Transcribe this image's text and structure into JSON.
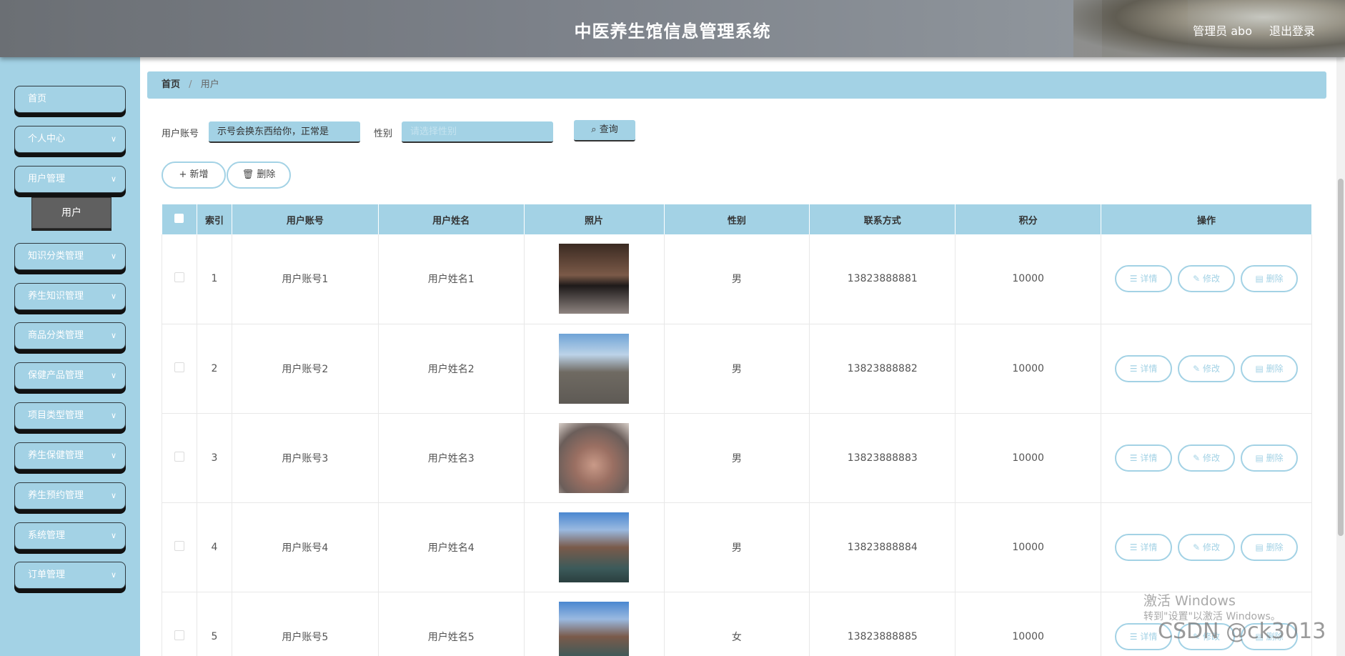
{
  "header": {
    "title": "中医养生馆信息管理系统",
    "user": "管理员 abo",
    "logout": "退出登录"
  },
  "sidebar": {
    "items": [
      {
        "label": "首页",
        "expandable": false
      },
      {
        "label": "个人中心",
        "expandable": true
      },
      {
        "label": "用户管理",
        "expandable": true
      },
      {
        "label": "知识分类管理",
        "expandable": true
      },
      {
        "label": "养生知识管理",
        "expandable": true
      },
      {
        "label": "商品分类管理",
        "expandable": true
      },
      {
        "label": "保健产品管理",
        "expandable": true
      },
      {
        "label": "项目类型管理",
        "expandable": true
      },
      {
        "label": "养生保健管理",
        "expandable": true
      },
      {
        "label": "养生预约管理",
        "expandable": true
      },
      {
        "label": "系统管理",
        "expandable": true
      },
      {
        "label": "订单管理",
        "expandable": true
      }
    ],
    "active_submenu": "用户"
  },
  "breadcrumb": {
    "home": "首页",
    "separator": "/",
    "current": "用户"
  },
  "search": {
    "account_label": "用户账号",
    "account_value": "示号会换东西给你，正常是",
    "gender_label": "性别",
    "gender_placeholder": "请选择性别",
    "query_label": "查询"
  },
  "actions": {
    "add_label": "新增",
    "delete_label": "删除"
  },
  "table": {
    "columns": [
      "索引",
      "用户账号",
      "用户姓名",
      "照片",
      "性别",
      "联系方式",
      "积分",
      "操作"
    ],
    "rows": [
      {
        "index": "1",
        "account": "用户账号1",
        "name": "用户姓名1",
        "gender": "男",
        "phone": "13823888881",
        "points": "10000"
      },
      {
        "index": "2",
        "account": "用户账号2",
        "name": "用户姓名2",
        "gender": "男",
        "phone": "13823888882",
        "points": "10000"
      },
      {
        "index": "3",
        "account": "用户账号3",
        "name": "用户姓名3",
        "gender": "男",
        "phone": "13823888883",
        "points": "10000"
      },
      {
        "index": "4",
        "account": "用户账号4",
        "name": "用户姓名4",
        "gender": "男",
        "phone": "13823888884",
        "points": "10000"
      },
      {
        "index": "5",
        "account": "用户账号5",
        "name": "用户姓名5",
        "gender": "女",
        "phone": "13823888885",
        "points": "10000"
      }
    ],
    "ops": {
      "detail": "详情",
      "edit": "修改",
      "delete": "删除"
    }
  },
  "overlay": {
    "windows_activate_title": "激活 Windows",
    "windows_activate_sub": "转到\"设置\"以激活 Windows。",
    "csdn_watermark": "CSDN @ck3013"
  },
  "colors": {
    "accent": "#a3d2e5",
    "header": "#7c8189",
    "submenu_active": "#606060"
  }
}
